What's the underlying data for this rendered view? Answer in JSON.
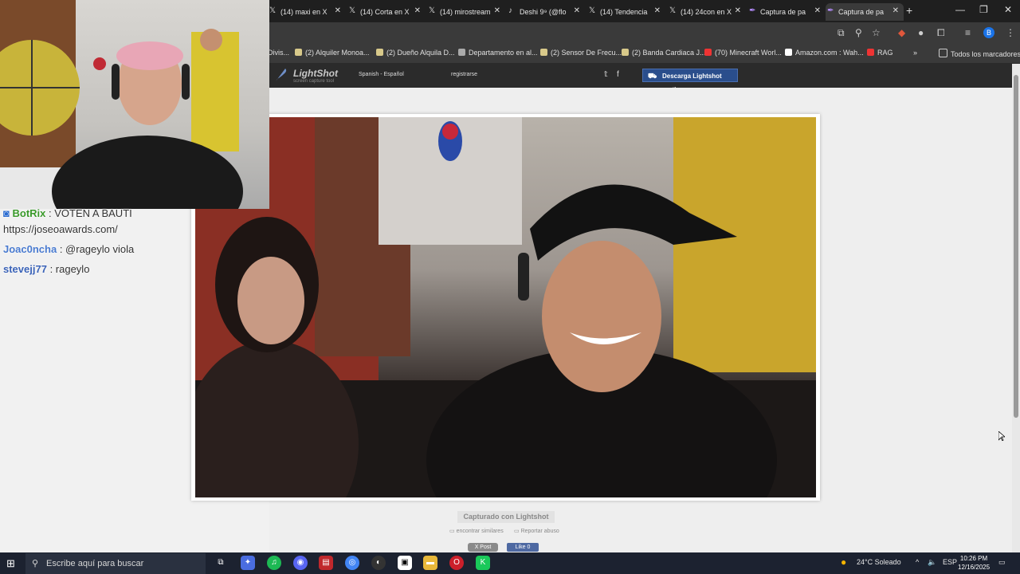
{
  "tabs": [
    {
      "label": "(14) maxi en X",
      "icon": "x-logo-icon"
    },
    {
      "label": "(14) Corta en X",
      "icon": "x-logo-icon"
    },
    {
      "label": "(14) mirostream",
      "icon": "x-logo-icon"
    },
    {
      "label": "Deshi 9⁹ (@flo",
      "icon": "tiktok-icon"
    },
    {
      "label": "(14) Tendencia",
      "icon": "x-logo-icon"
    },
    {
      "label": "(14) 24con en X",
      "icon": "x-logo-icon"
    },
    {
      "label": "Captura de pa",
      "icon": "lightshot-icon"
    },
    {
      "label": "Captura de pa",
      "icon": "lightshot-icon",
      "active": true
    }
  ],
  "bookmarks": [
    {
      "label": "Divis..."
    },
    {
      "label": "(2) Alquiler Monoa..."
    },
    {
      "label": "(2) Dueño Alquila D..."
    },
    {
      "label": "Departamento en al..."
    },
    {
      "label": "(2) Sensor De Frecu..."
    },
    {
      "label": "(2) Banda Cardiaca J..."
    },
    {
      "label": "(70) Minecraft Worl..."
    },
    {
      "label": "Amazon.com : Wah..."
    },
    {
      "label": "RAG"
    },
    {
      "label": "»"
    },
    {
      "label": "Todos los marcadores"
    }
  ],
  "profile_initial": "B",
  "lightshot": {
    "logo": "LightShot",
    "logo_sub": "screen capture tool",
    "language": "Spanish - Español",
    "register": "registrarse",
    "twitter": "𝕥",
    "facebook": "f",
    "download": "Descarga Lightshot gratis",
    "captured_with": "Capturado con Lightshot",
    "find_similar": "encontrar similares",
    "report": "Reportar abuso",
    "x_post": "X Post",
    "fb_like": "Like 0"
  },
  "chat": [
    {
      "user": "BotRix",
      "text": ": VOTEN A BAUTI",
      "user_color": "#3a9a2a"
    },
    {
      "user": "",
      "text": "https://joseoawards.com/",
      "user_color": "#333333"
    },
    {
      "user": "Joac0ncha",
      "text": ": @rageylo viola",
      "user_color": "#4a7bd0"
    },
    {
      "user": "stevejj77",
      "text": ": rageylo",
      "user_color": "#3b63b8"
    }
  ],
  "taskbar": {
    "search_placeholder": "Escribe aquí para buscar",
    "weather": "24°C  Soleado",
    "lang": "ESP",
    "time": "10:26 PM",
    "date": "12/16/2025"
  },
  "colors": {
    "accent": "#2a4e8c",
    "chrome_bg": "#1f1f1f",
    "taskbar_bg": "#1c2230"
  }
}
